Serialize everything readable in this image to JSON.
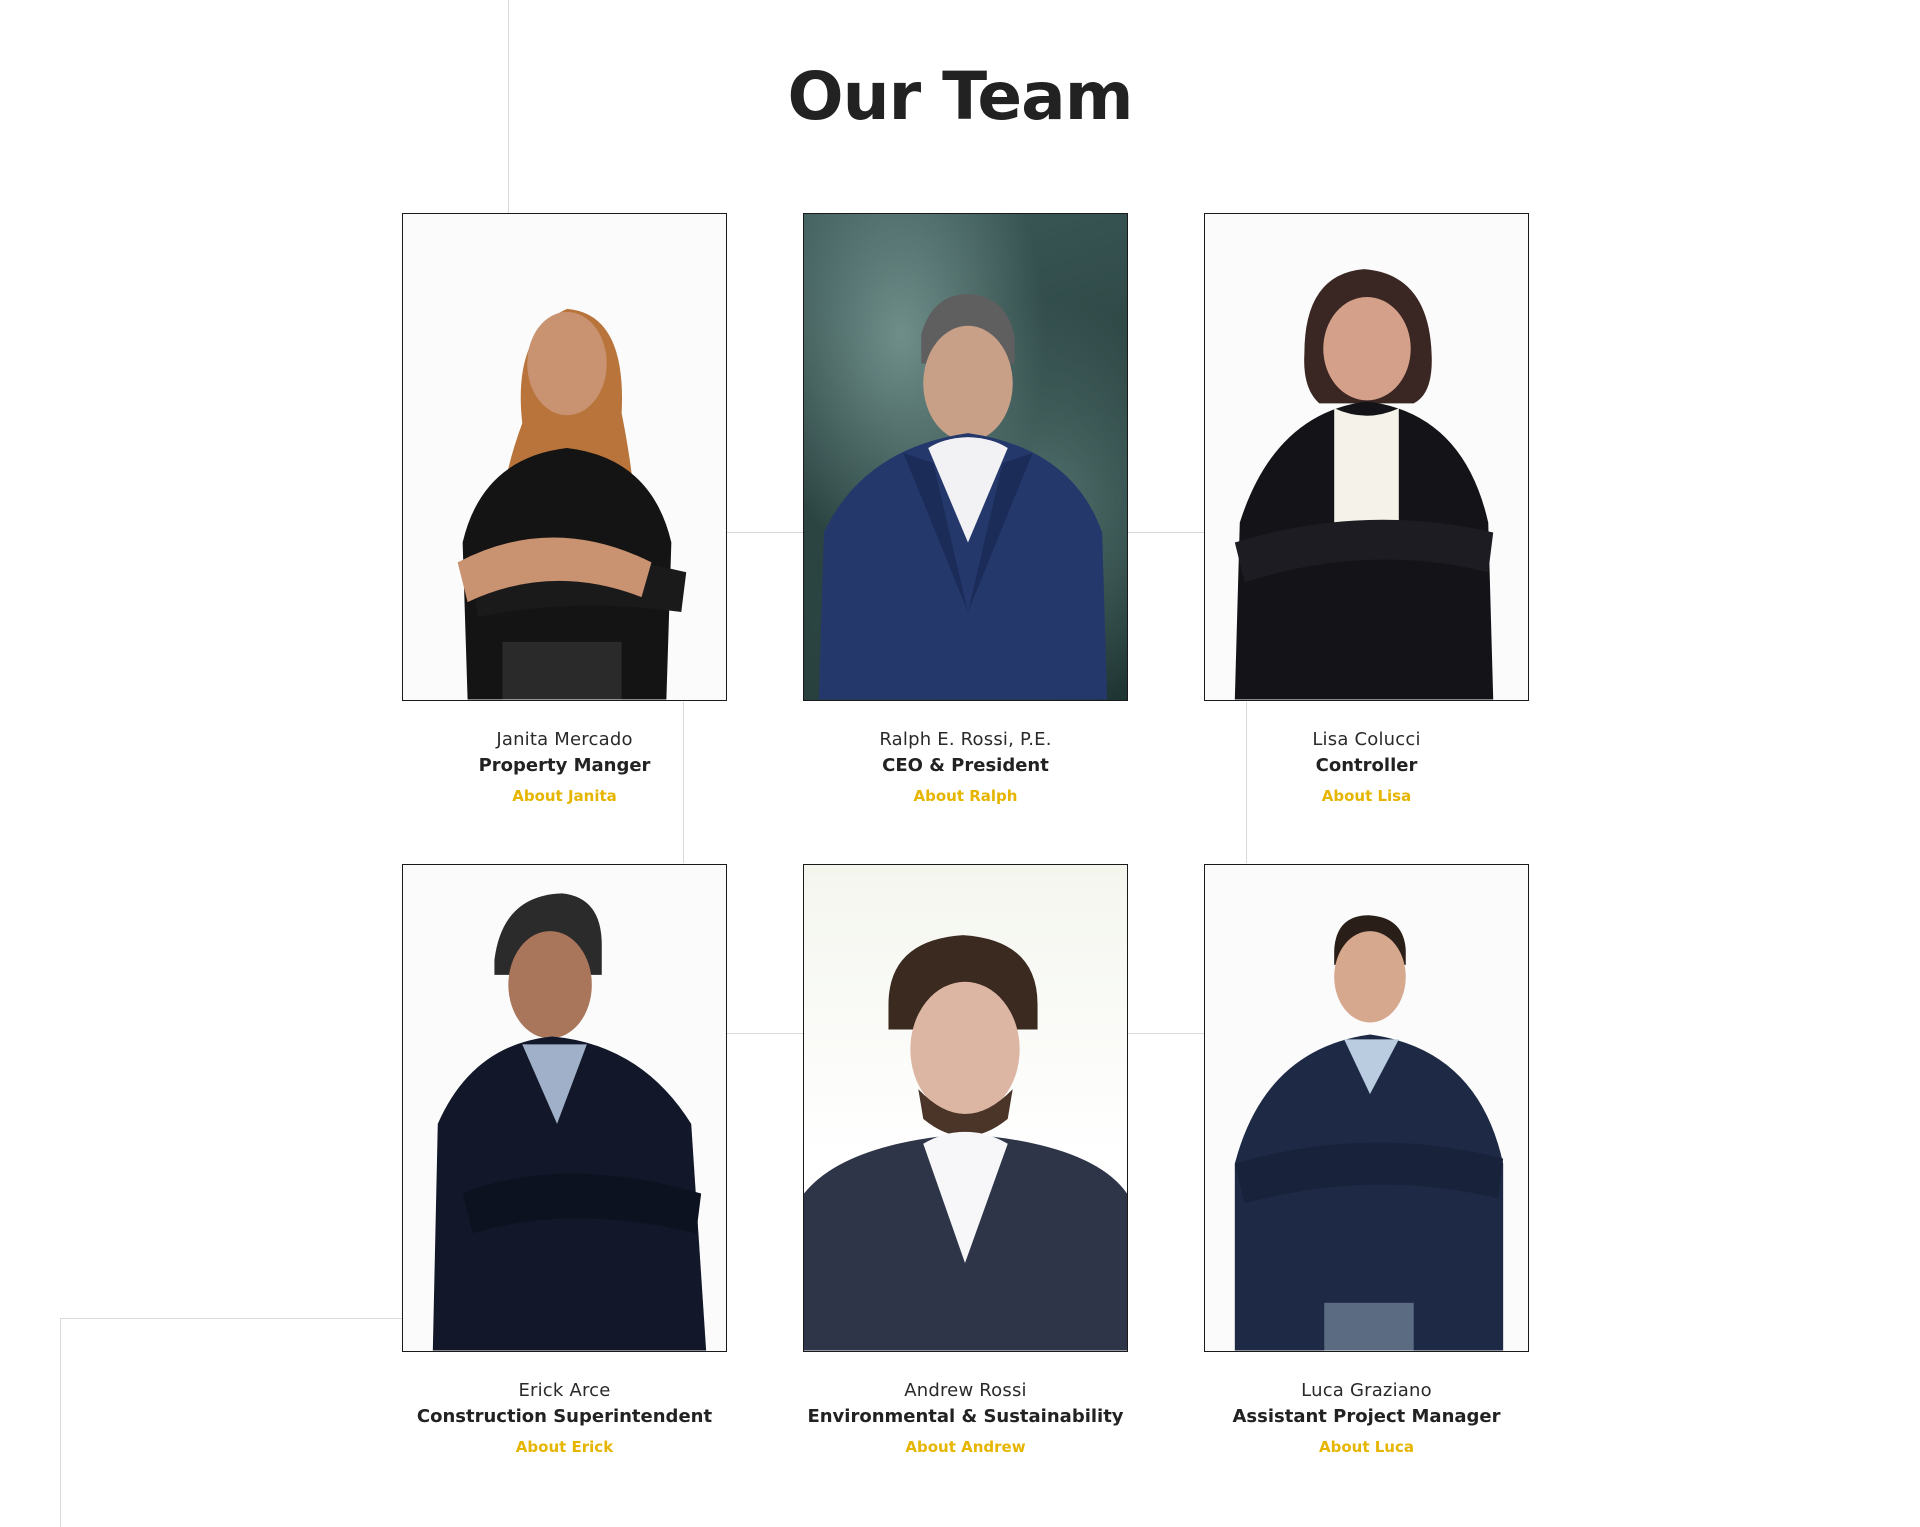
{
  "section": {
    "title": "Our Team"
  },
  "colors": {
    "accent": "#e6b500",
    "text": "#222222",
    "lines": "#d9d9d9"
  },
  "team": [
    {
      "name": "Janita Mercado",
      "role": "Property Manger",
      "link": "About Janita",
      "photo": "portrait-janita"
    },
    {
      "name": "Ralph E. Rossi, P.E.",
      "role": "CEO & President",
      "link": "About Ralph",
      "photo": "portrait-ralph"
    },
    {
      "name": "Lisa Colucci",
      "role": "Controller",
      "link": "About Lisa",
      "photo": "portrait-lisa"
    },
    {
      "name": "Erick Arce",
      "role": "Construction Superintendent",
      "link": "About Erick",
      "photo": "portrait-erick"
    },
    {
      "name": "Andrew Rossi",
      "role": "Environmental & Sustainability",
      "link": "About Andrew",
      "photo": "portrait-andrew"
    },
    {
      "name": "Luca Graziano",
      "role": "Assistant Project Manager",
      "link": "About Luca",
      "photo": "portrait-luca"
    }
  ]
}
